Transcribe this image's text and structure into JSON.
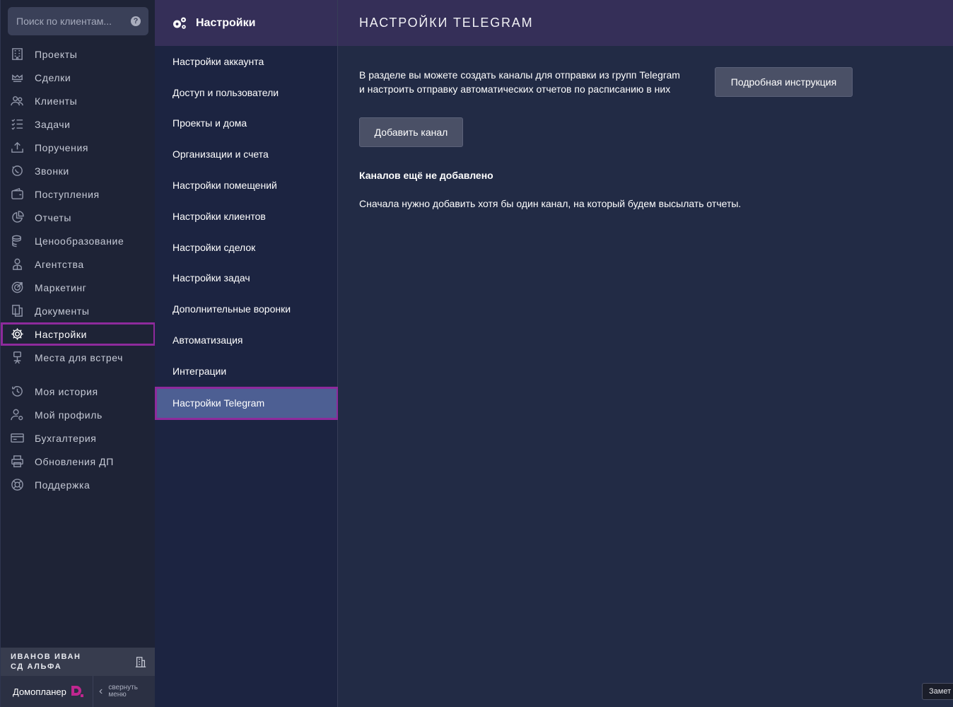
{
  "search": {
    "placeholder": "Поиск по клиентам...",
    "help_icon": "?"
  },
  "sidebar": {
    "items": [
      {
        "label": "Проекты",
        "icon": "building-icon"
      },
      {
        "label": "Сделки",
        "icon": "handshake-icon"
      },
      {
        "label": "Клиенты",
        "icon": "users-icon"
      },
      {
        "label": "Задачи",
        "icon": "checklist-icon"
      },
      {
        "label": "Поручения",
        "icon": "tray-upload-icon"
      },
      {
        "label": "Звонки",
        "icon": "phone-call-icon"
      },
      {
        "label": "Поступления",
        "icon": "wallet-icon"
      },
      {
        "label": "Отчеты",
        "icon": "pie-chart-icon"
      },
      {
        "label": "Ценообразование",
        "icon": "coins-icon"
      },
      {
        "label": "Агентства",
        "icon": "agent-icon"
      },
      {
        "label": "Маркетинг",
        "icon": "target-icon"
      },
      {
        "label": "Документы",
        "icon": "documents-icon"
      },
      {
        "label": "Настройки",
        "icon": "gear-icon",
        "active": true
      },
      {
        "label": "Места для встреч",
        "icon": "meeting-place-icon"
      }
    ],
    "secondary": [
      {
        "label": "Моя история",
        "icon": "history-icon"
      },
      {
        "label": "Мой профиль",
        "icon": "profile-gear-icon"
      },
      {
        "label": "Бухгалтерия",
        "icon": "credit-card-icon"
      },
      {
        "label": "Обновления ДП",
        "icon": "printer-icon"
      },
      {
        "label": "Поддержка",
        "icon": "lifebuoy-icon"
      }
    ],
    "user": {
      "name": "ИВАНОВ ИВАН",
      "org": "СД АЛЬФА"
    },
    "brand": {
      "name": "Домопланер",
      "logo_letter": "D",
      "collapse_line1": "свернуть",
      "collapse_line2": "меню"
    }
  },
  "settings": {
    "title": "Настройки",
    "items": [
      "Настройки аккаунта",
      "Доступ и пользователи",
      "Проекты и дома",
      "Организации и счета",
      "Настройки помещений",
      "Настройки клиентов",
      "Настройки сделок",
      "Настройки задач",
      "Дополнительные воронки",
      "Автоматизация",
      "Интеграции",
      "Настройки Telegram"
    ],
    "active_index": 11
  },
  "main": {
    "title": "НАСТРОЙКИ TELEGRAM",
    "intro_line1": "В разделе вы можете создать каналы для отправки из групп Telegram",
    "intro_line2": "и настроить отправку автоматических отчетов по расписанию в них",
    "guide_button": "Подробная инструкция",
    "add_button": "Добавить канал",
    "empty_title": "Каналов ещё не добавлено",
    "empty_text": "Сначала нужно добавить хотя бы один канал, на который будем высылать отчеты."
  },
  "notes_tab": "Замет",
  "colors": {
    "accent": "#8e2a9c",
    "header": "#352f58",
    "active_item": "#4d5f93",
    "brand_logo": "#c0268f"
  }
}
